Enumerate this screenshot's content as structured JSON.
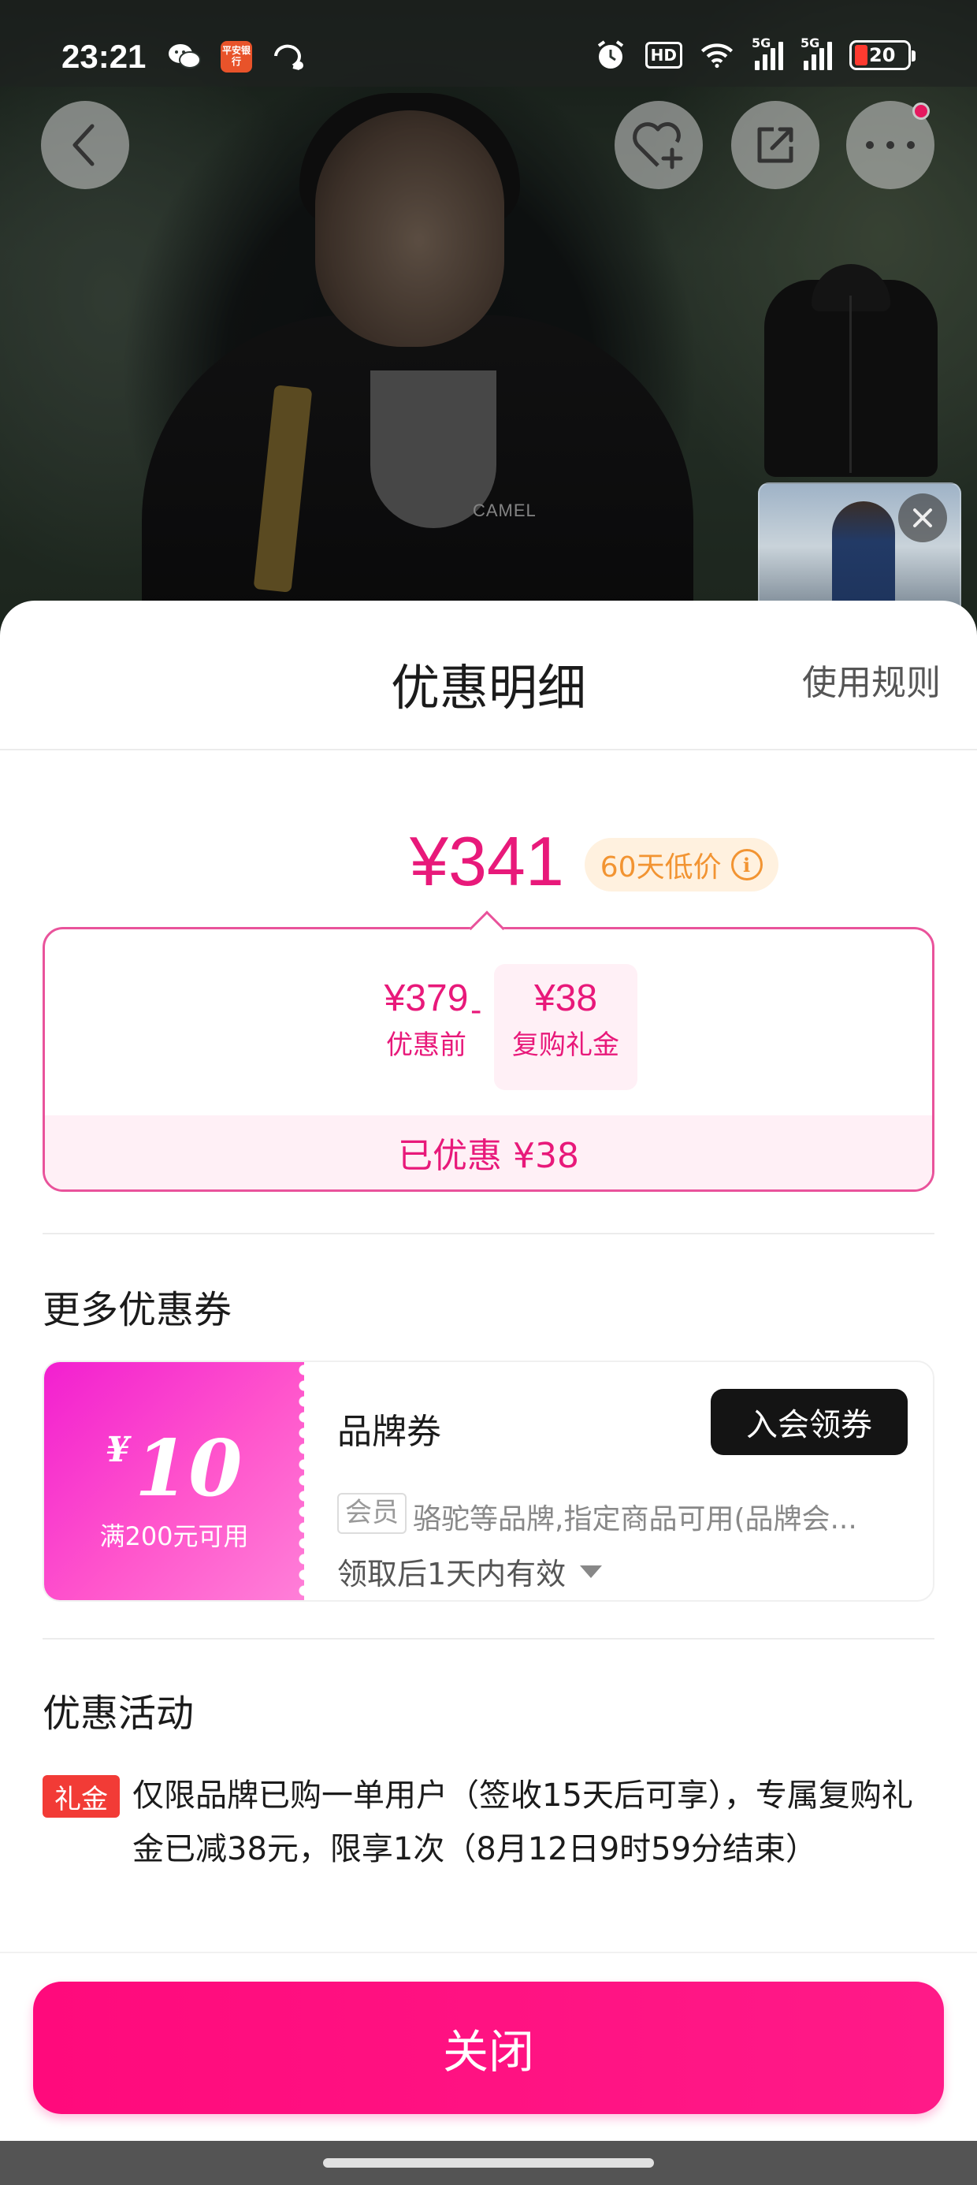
{
  "status_bar": {
    "time": "23:21",
    "bank_icon_text": "平安银行",
    "hd_label": "HD",
    "signal1_label": "5G",
    "signal2_label": "5G",
    "battery": "20"
  },
  "hero": {
    "brand_logo_text": "CAMEL"
  },
  "sheet": {
    "title": "优惠明细",
    "rules_link": "使用规则",
    "final_price": "¥341",
    "low_price_badge": "60天低价",
    "breakdown": {
      "original_amount": "¥379",
      "original_label": "优惠前",
      "minus": "-",
      "discount_amount": "¥38",
      "discount_label": "复购礼金",
      "saved_text": "已优惠 ¥38"
    },
    "more_coupons_title": "更多优惠券",
    "coupon": {
      "currency": "¥",
      "amount": "10",
      "condition": "满200元可用",
      "name": "品牌券",
      "join_button": "入会领券",
      "member_tag": "会员",
      "description": "骆驼等品牌,指定商品可用(品牌会...",
      "validity": "领取后1天内有效"
    },
    "activities_title": "优惠活动",
    "activity": {
      "tag": "礼金",
      "text": "仅限品牌已购一单用户（签收15天后可享），专属复购礼金已减38元，限享1次（8月12日9时59分结束）"
    },
    "close_button": "关闭"
  },
  "colors": {
    "accent": "#e8197a",
    "badge_orange": "#f29432",
    "gift_red": "#f23b36",
    "close_button": "#ff0a7c"
  }
}
